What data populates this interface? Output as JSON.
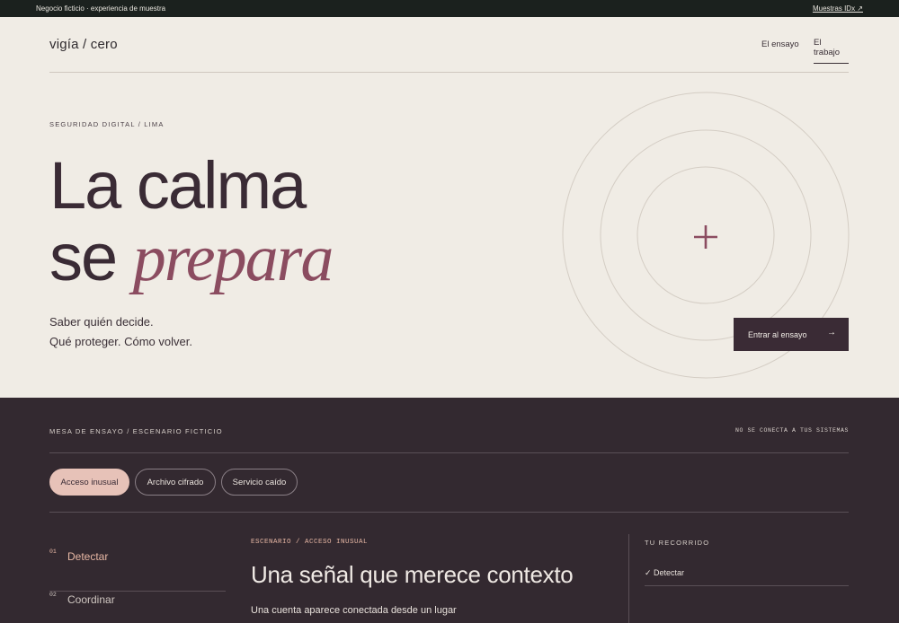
{
  "topbar": {
    "note": "Negocio ficticio · experiencia de muestra",
    "link": "Muestras IDx ↗"
  },
  "header": {
    "brand": "vigía / cero",
    "nav": [
      "El ensayo",
      "El trabajo"
    ]
  },
  "hero": {
    "eyebrow": "SEGURIDAD DIGITAL / LIMA",
    "line1": "La calma",
    "line2_plain": "se ",
    "line2_accent": "prepara",
    "sub1": "Saber quién decide.",
    "sub2": "Qué proteger. Cómo volver.",
    "cta": "Entrar al ensayo",
    "cta_icon": "arrow-right-icon",
    "plus_icon": "plus-icon",
    "accent_color": "#8b4c60"
  },
  "board": {
    "eyebrow": "MESA DE ENSAYO / ESCENARIO FICTICIO",
    "note": "NO SE CONECTA A TUS SISTEMAS",
    "tabs": [
      "Acceso inusual",
      "Archivo cifrado",
      "Servicio caído"
    ],
    "steps": [
      {
        "num": "01",
        "label": "Detectar"
      },
      {
        "num": "02",
        "label": "Coordinar"
      }
    ],
    "scenario_tag": "ESCENARIO / ACCESO INUSUAL",
    "scenario_title": "Una señal que merece contexto",
    "scenario_body": "Una cuenta aparece conectada desde un lugar",
    "route_title": "TU RECORRIDO",
    "route_items": [
      "✓ Detectar"
    ],
    "active_color": "#e7c2b8"
  }
}
